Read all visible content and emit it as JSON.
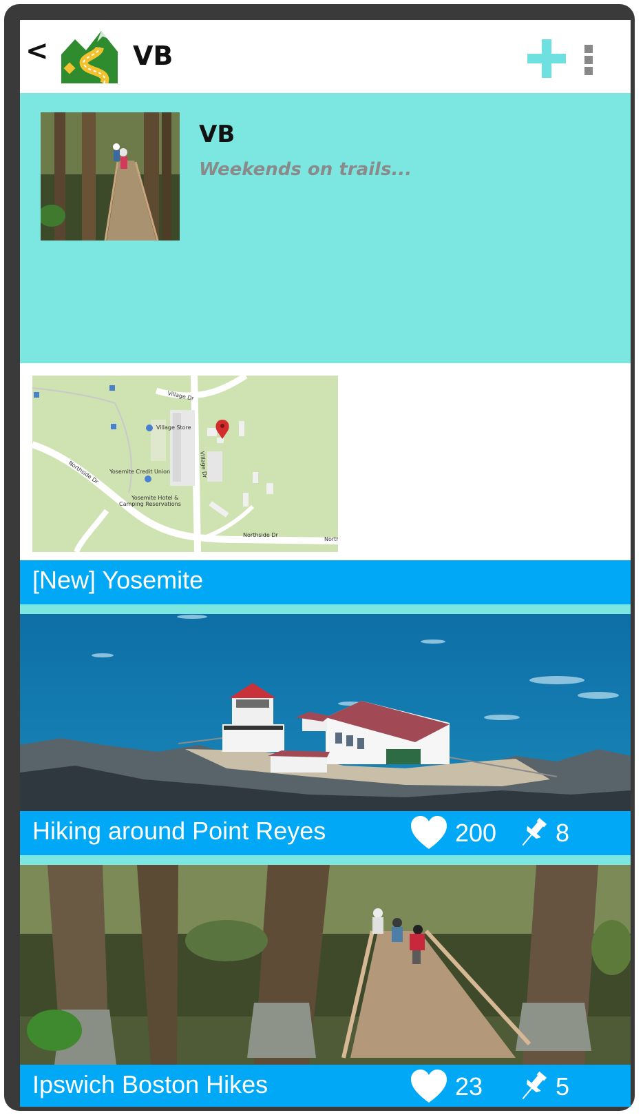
{
  "header": {
    "back_label": "<",
    "title": "VB",
    "logo_icon": "trail-road-logo-icon",
    "add_icon": "plus-icon",
    "menu_icon": "kebab-menu-icon",
    "accent_color": "#7be7e0"
  },
  "profile": {
    "name": "VB",
    "tagline": "Weekends on trails..."
  },
  "map": {
    "labels": [
      "Village Store",
      "Yosemite Credit Union",
      "Yosemite Hotel &",
      "Camping Reservations",
      "Northside Dr",
      "Northside Dr",
      "Village Dr",
      "Village Dr",
      "North"
    ]
  },
  "trips": [
    {
      "title": "[New] Yosemite"
    },
    {
      "title": "Hiking around Point Reyes",
      "likes": "200",
      "pins": "8",
      "like_icon": "heart-icon",
      "pin_icon": "pushpin-icon"
    },
    {
      "title": "Ipswich Boston Hikes",
      "likes": "23",
      "pins": "5",
      "like_icon": "heart-icon",
      "pin_icon": "pushpin-icon"
    }
  ],
  "bar_color": "#00a8f5"
}
